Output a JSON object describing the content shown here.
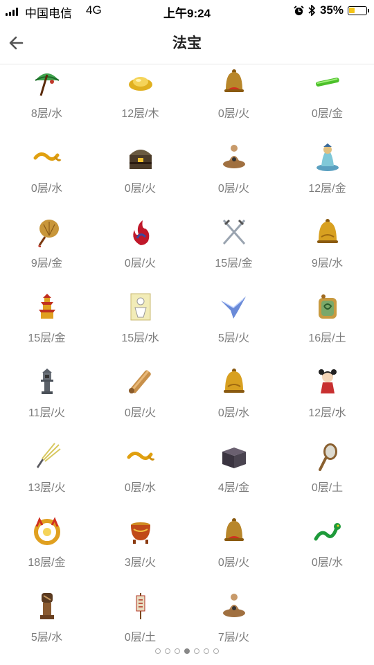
{
  "status": {
    "carrier": "中国电信",
    "network": "4G",
    "time": "上午9:24",
    "battery": "35%",
    "battery_level": 0.35
  },
  "header": {
    "title": "法宝"
  },
  "items": [
    {
      "label": "8层/水",
      "icon": "umbrella-icon"
    },
    {
      "label": "12层/木",
      "icon": "gold-ingot-icon"
    },
    {
      "label": "0层/火",
      "icon": "red-bell-icon"
    },
    {
      "label": "0层/金",
      "icon": "jade-rod-icon"
    },
    {
      "label": "0层/水",
      "icon": "golden-rope-icon"
    },
    {
      "label": "0层/火",
      "icon": "treasure-chest-icon"
    },
    {
      "label": "0层/火",
      "icon": "meditating-figure-icon"
    },
    {
      "label": "12层/金",
      "icon": "jade-statue-icon"
    },
    {
      "label": "9层/金",
      "icon": "palm-fan-icon"
    },
    {
      "label": "0层/火",
      "icon": "red-flame-icon"
    },
    {
      "label": "15层/金",
      "icon": "twin-swords-icon"
    },
    {
      "label": "9层/水",
      "icon": "golden-bell-icon"
    },
    {
      "label": "15层/金",
      "icon": "pagoda-icon"
    },
    {
      "label": "15层/水",
      "icon": "paper-doll-icon"
    },
    {
      "label": "5层/火",
      "icon": "blue-bird-icon"
    },
    {
      "label": "16层/土",
      "icon": "jade-tablet-icon"
    },
    {
      "label": "11层/火",
      "icon": "stone-lantern-icon"
    },
    {
      "label": "0层/火",
      "icon": "scroll-icon"
    },
    {
      "label": "0层/水",
      "icon": "golden-bell-icon"
    },
    {
      "label": "12层/水",
      "icon": "child-doll-icon"
    },
    {
      "label": "13层/火",
      "icon": "lightning-whisk-icon"
    },
    {
      "label": "0层/水",
      "icon": "golden-rope-icon"
    },
    {
      "label": "4层/金",
      "icon": "dark-box-icon"
    },
    {
      "label": "0层/土",
      "icon": "hand-mirror-icon"
    },
    {
      "label": "18层/金",
      "icon": "golden-crown-icon"
    },
    {
      "label": "3层/火",
      "icon": "cauldron-icon"
    },
    {
      "label": "0层/火",
      "icon": "red-bell-icon"
    },
    {
      "label": "0层/水",
      "icon": "green-dragon-icon"
    },
    {
      "label": "5层/水",
      "icon": "seal-icon"
    },
    {
      "label": "0层/土",
      "icon": "banner-icon"
    },
    {
      "label": "7层/火",
      "icon": "meditating-figure-icon"
    }
  ],
  "pager": {
    "count": 7,
    "current": 3
  }
}
